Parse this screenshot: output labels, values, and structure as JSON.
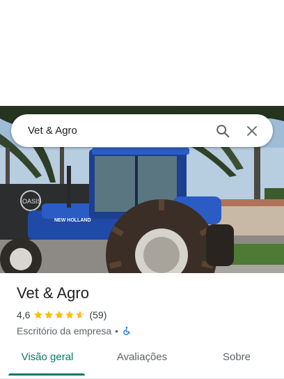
{
  "search": {
    "query": "Vet & Agro"
  },
  "place": {
    "name": "Vet & Agro",
    "rating": "4,6",
    "stars": 4.6,
    "review_count": "(59)",
    "category": "Escritório da empresa",
    "separator": "•",
    "accessibility_icon": "wheelchair-icon"
  },
  "hero": {
    "sign_text": "OASIS",
    "tractor_brand": "NEW HOLLAND"
  },
  "tabs": [
    {
      "label": "Visão geral",
      "active": true
    },
    {
      "label": "Avaliações",
      "active": false
    },
    {
      "label": "Sobre",
      "active": false
    }
  ],
  "colors": {
    "accent": "#00796b",
    "star": "#fbbc04",
    "accessibility": "#1a73e8"
  }
}
